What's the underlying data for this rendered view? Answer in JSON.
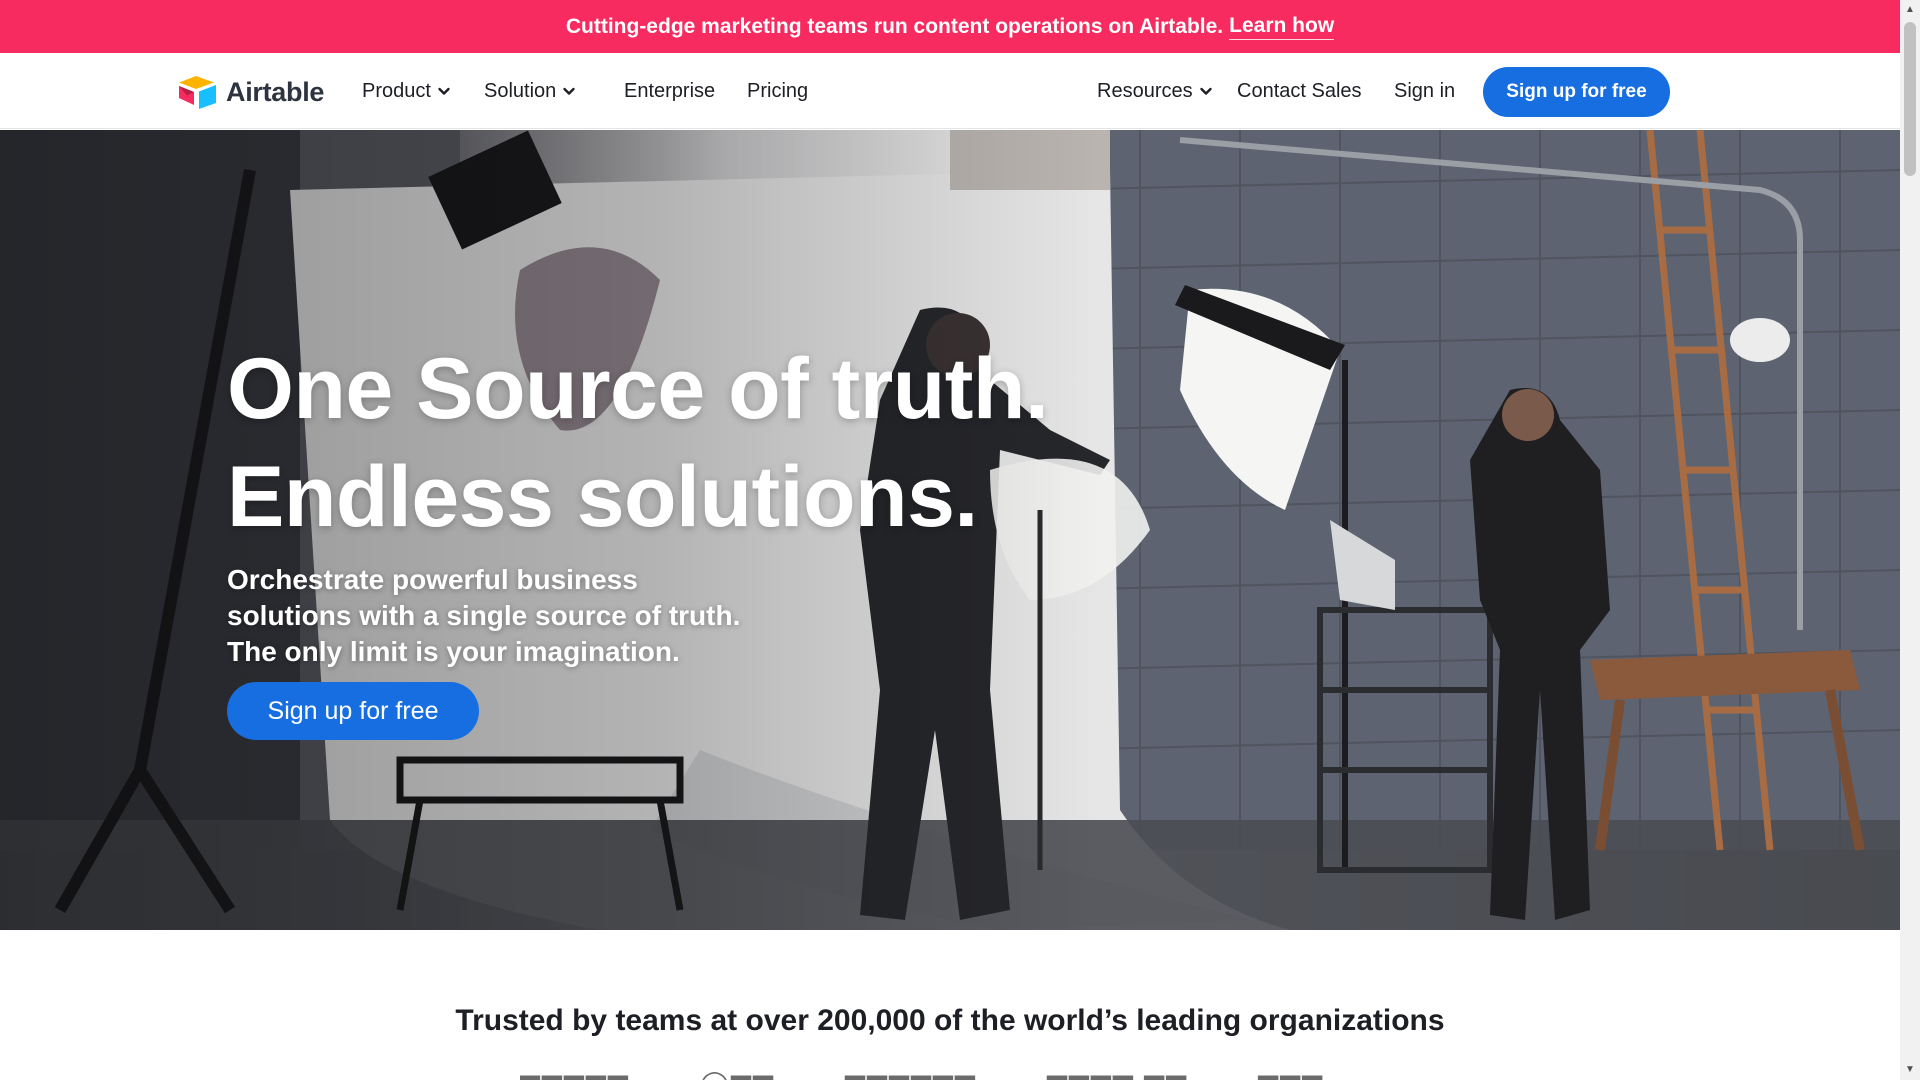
{
  "banner": {
    "text": "Cutting-edge marketing teams run content operations on Airtable.",
    "link_label": "Learn how"
  },
  "nav": {
    "logo_text": "Airtable",
    "items": [
      {
        "label": "Product",
        "has_dropdown": true
      },
      {
        "label": "Solution",
        "has_dropdown": true
      },
      {
        "label": "Enterprise",
        "has_dropdown": false
      },
      {
        "label": "Pricing",
        "has_dropdown": false
      }
    ],
    "right_items": [
      {
        "label": "Resources",
        "has_dropdown": true
      },
      {
        "label": "Contact Sales",
        "has_dropdown": false
      },
      {
        "label": "Sign in",
        "has_dropdown": false
      }
    ],
    "cta_label": "Sign up for free"
  },
  "hero": {
    "title_line1": "One Source of truth.",
    "title_line2": "Endless solutions.",
    "subtitle": "Orchestrate powerful business solutions with a single source of truth. The only limit is your imagination.",
    "cta_label": "Sign up for free"
  },
  "trusted": {
    "heading": "Trusted by teams at over 200,000 of the world’s leading organizations"
  },
  "colors": {
    "banner": "#f82b60",
    "primary_button": "#166ee1",
    "text": "#1d1f25"
  },
  "icons": [
    "airtable-logo-icon",
    "chevron-down-icon"
  ]
}
